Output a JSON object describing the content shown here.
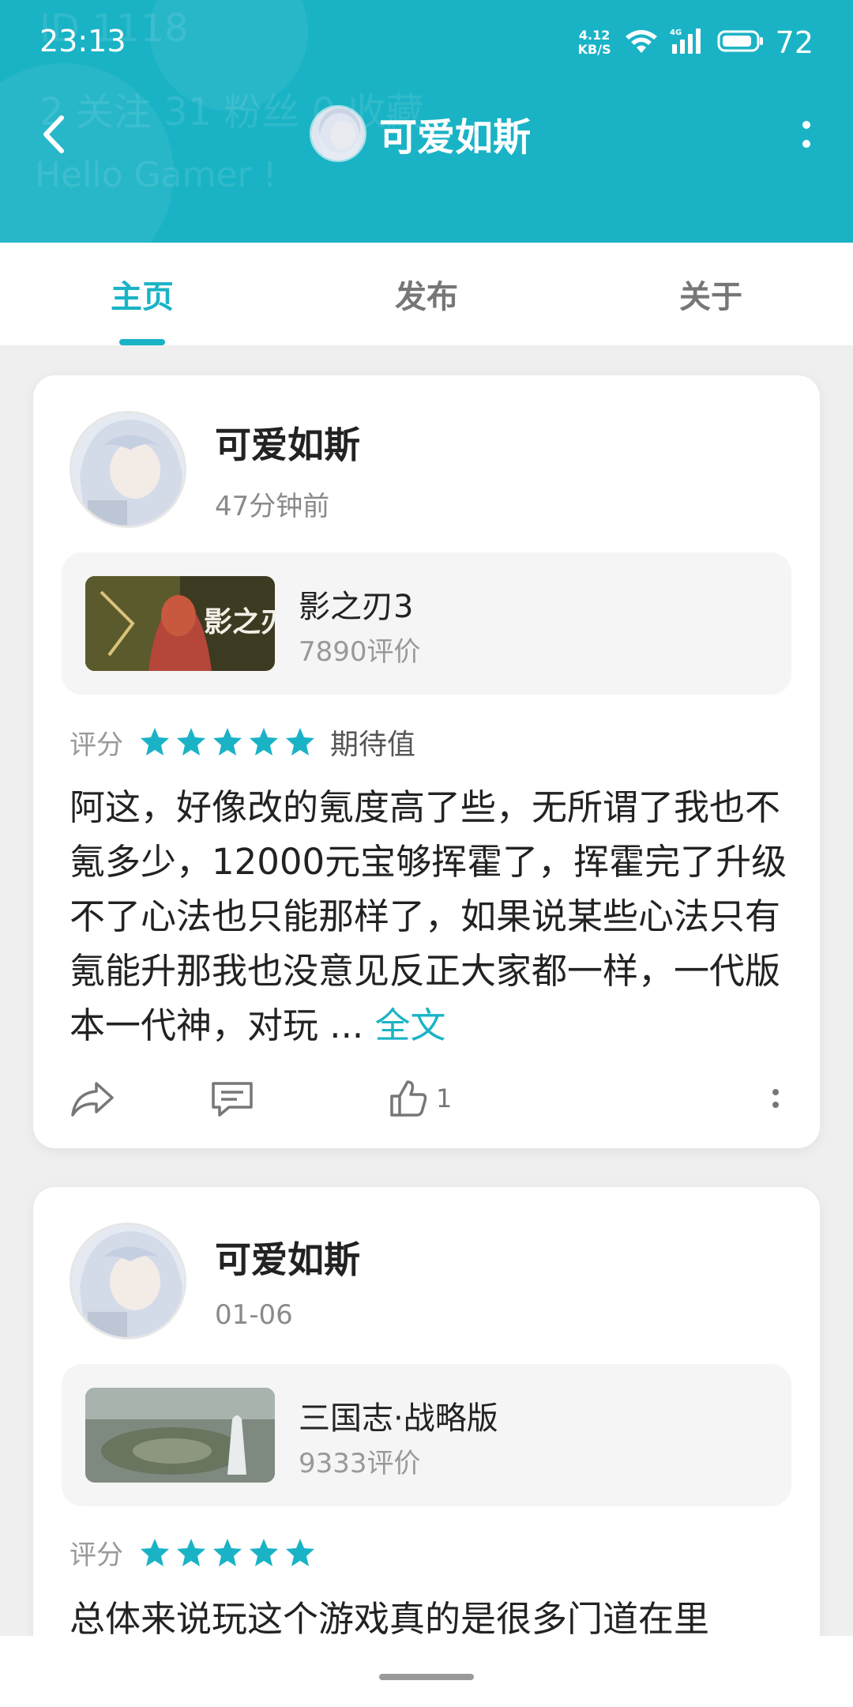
{
  "status_bar": {
    "time": "23:13",
    "net_speed_value": "4.12",
    "net_speed_unit": "KB/S",
    "battery": "72",
    "icons": [
      "wifi-icon",
      "signal-4g-icon",
      "battery-icon"
    ]
  },
  "header": {
    "ghost_line1": "ID 1118",
    "ghost_line2": "2 关注   31 粉丝   0 收藏",
    "ghost_line3": "Hello Gamer !",
    "title": "可爱如斯",
    "accent_color": "#1ab3c6"
  },
  "tabs": [
    {
      "label": "主页",
      "active": true
    },
    {
      "label": "发布",
      "active": false
    },
    {
      "label": "关于",
      "active": false
    }
  ],
  "posts": [
    {
      "author": "可爱如斯",
      "time": "47分钟前",
      "game": {
        "title": "影之刃3",
        "reviews": "7890评价"
      },
      "rating_label": "评分",
      "stars": 5,
      "rating_tag": "期待值",
      "text": "阿这，好像改的氪度高了些，无所谓了我也不氪多少，12000元宝够挥霍了，挥霍完了升级不了心法也只能那样了，如果说某些心法只有氪能升那我也没意见反正大家都一样，一代版本一代神，对玩 ...",
      "read_more": "全文",
      "likes": "1"
    },
    {
      "author": "可爱如斯",
      "time": "01-06",
      "game": {
        "title": "三国志·战略版",
        "reviews": "9333评价"
      },
      "rating_label": "评分",
      "stars": 5,
      "text": "总体来说玩这个游戏真的是很多门道在里"
    }
  ]
}
